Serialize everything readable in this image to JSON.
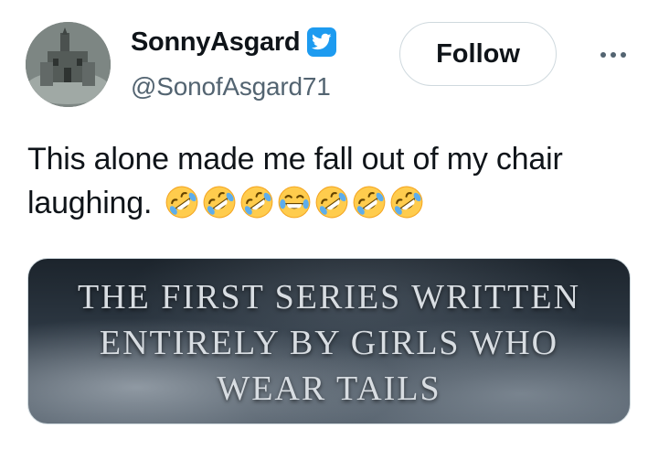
{
  "user": {
    "display_name": "SonnyAsgard",
    "handle": "@SonofAsgard71",
    "verified_icon": "twitter-bird-badge-icon",
    "badge_color": "#1d9bf0"
  },
  "actions": {
    "follow_label": "Follow",
    "more_icon": "more-options-icon"
  },
  "tweet": {
    "text": "This alone made me fall out of my chair laughing.",
    "emojis": [
      "rolling-on-floor-laughing",
      "rolling-on-floor-laughing",
      "rolling-on-floor-laughing",
      "face-with-tears-of-joy",
      "rolling-on-floor-laughing",
      "rolling-on-floor-laughing",
      "rolling-on-floor-laughing"
    ]
  },
  "media": {
    "lines": [
      "The first series written",
      "entirely by girls who",
      "wear tails"
    ]
  },
  "colors": {
    "text_primary": "#0f1419",
    "text_secondary": "#536471",
    "border": "#cfd9de"
  }
}
